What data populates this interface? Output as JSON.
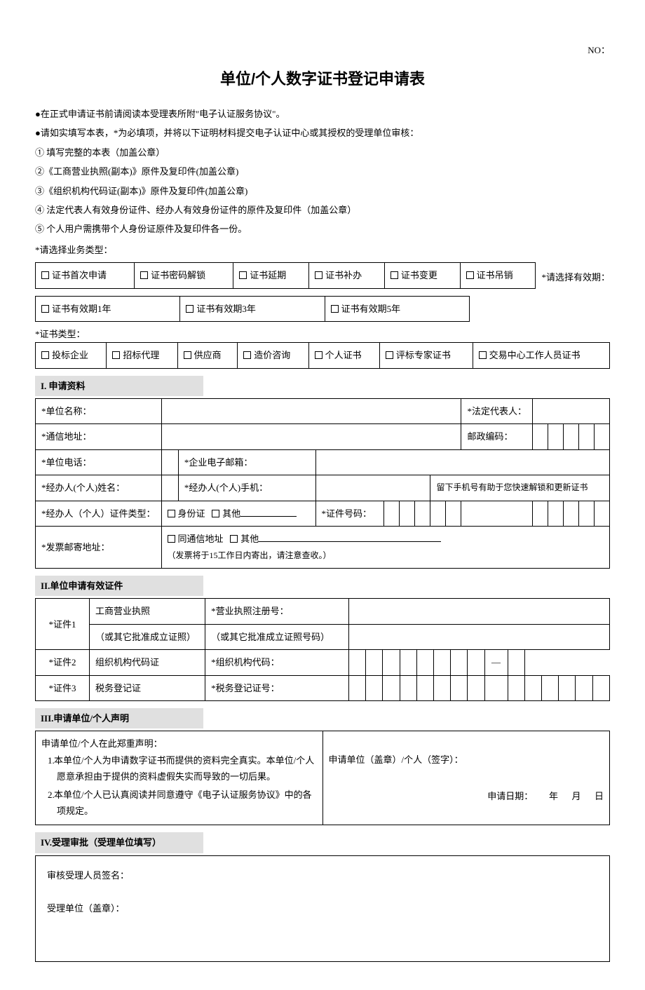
{
  "header": {
    "no": "NO：",
    "title": "单位/个人数字证书登记申请表"
  },
  "intro": {
    "l1": "●在正式申请证书前请阅读本受理表所附\"电子认证服务协议\"。",
    "l2": "●请如实填写本表，*为必填项，并将以下证明材料提交电子认证中心或其授权的受理单位审核：",
    "l3": "① 填写完整的本表（加盖公章）",
    "l4": "②《工商营业执照(副本)》原件及复印件(加盖公章)",
    "l5": "③《组织机构代码证(副本)》原件及复印件(加盖公章)",
    "l6": "④ 法定代表人有效身份证件、经办人有效身份证件的原件及复印件（加盖公章）",
    "l7": "⑤ 个人用户需携带个人身份证原件及复印件各一份。"
  },
  "biz": {
    "select_label": "*请选择业务类型：",
    "opts": [
      "证书首次申请",
      "证书密码解锁",
      "证书延期",
      "证书补办",
      "证书变更",
      "证书吊销"
    ],
    "validity_label": "*请选择有效期：",
    "validity_opts": [
      "证书有效期1年",
      "证书有效期3年",
      "证书有效期5年"
    ],
    "cert_type_label": "*证书类型：",
    "cert_opts": [
      "投标企业",
      "招标代理",
      "供应商",
      "造价咨询",
      "个人证书",
      "评标专家证书",
      "交易中心工作人员证书"
    ]
  },
  "s1": {
    "header": "I. 申请资料",
    "unit_name": "*单位名称：",
    "legal_rep": "*法定代表人：",
    "addr": "*通信地址：",
    "zip": "邮政编码：",
    "tel": "*单位电话：",
    "email": "*企业电子邮箱：",
    "agent_name": "*经办人(个人)姓名：",
    "agent_mobile": "*经办人(个人)手机：",
    "mobile_hint": "留下手机号有助于您快速解锁和更新证书",
    "id_type": "*经办人（个人）证件类型：",
    "id_card": "身份证",
    "other": "其他",
    "id_no": "*证件号码：",
    "invoice_addr": "*发票邮寄地址：",
    "same_addr": "同通信地址",
    "invoice_note": "（发票将于15工作日内寄出，请注意查收。）"
  },
  "s2": {
    "header": "II.单位申请有效证件",
    "cert1": "*证件1",
    "cert1_name": "工商营业执照",
    "cert1_no": "*营业执照注册号：",
    "cert1_alt": "（或其它批准成立证照）",
    "cert1_alt_no": "（或其它批准成立证照号码）",
    "cert2": "*证件2",
    "cert2_name": "组织机构代码证",
    "cert2_no": "*组织机构代码：",
    "dash": "—",
    "cert3": "*证件3",
    "cert3_name": "税务登记证",
    "cert3_no": "*税务登记证号："
  },
  "s3": {
    "header": "III.申请单位/个人声明",
    "intro": "申请单位/个人在此郑重声明：",
    "d1": "本单位/个人为申请数字证书而提供的资料完全真实。本单位/个人愿意承担由于提供的资料虚假失实而导致的一切后果。",
    "d2": "本单位/个人已认真阅读并同意遵守《电子认证服务协议》中的各项规定。",
    "stamp": "申请单位（盖章）/个人（签字）：",
    "date": "申请日期：",
    "y": "年",
    "m": "月",
    "d": "日"
  },
  "s4": {
    "header": "IV.受理审批（受理单位填写）",
    "reviewer": "审核受理人员签名：",
    "org": "受理单位（盖章）："
  }
}
